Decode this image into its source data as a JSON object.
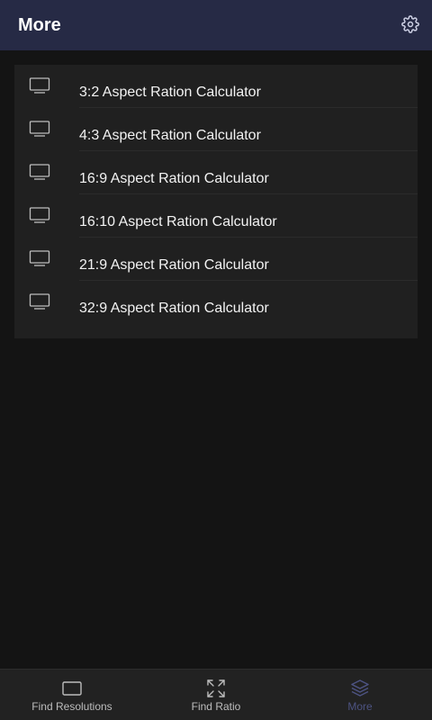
{
  "header": {
    "title": "More",
    "settings_icon": "gear-icon"
  },
  "list": {
    "items": [
      {
        "label": "3:2 Aspect Ration Calculator",
        "icon": "monitor-icon"
      },
      {
        "label": "4:3 Aspect Ration Calculator",
        "icon": "monitor-icon"
      },
      {
        "label": "16:9 Aspect Ration Calculator",
        "icon": "monitor-icon"
      },
      {
        "label": "16:10 Aspect Ration Calculator",
        "icon": "monitor-icon"
      },
      {
        "label": "21:9 Aspect Ration Calculator",
        "icon": "monitor-icon"
      },
      {
        "label": "32:9 Aspect Ration Calculator",
        "icon": "monitor-icon"
      }
    ]
  },
  "tabbar": {
    "tabs": [
      {
        "label": "Find Resolutions",
        "icon": "screen-icon",
        "active": false
      },
      {
        "label": "Find Ratio",
        "icon": "expand-arrows-icon",
        "active": false
      },
      {
        "label": "More",
        "icon": "layers-icon",
        "active": true
      }
    ]
  },
  "colors": {
    "header_bg": "#262a45",
    "active_tab": "#4d5382",
    "background": "#141414",
    "panel": "#202020"
  }
}
